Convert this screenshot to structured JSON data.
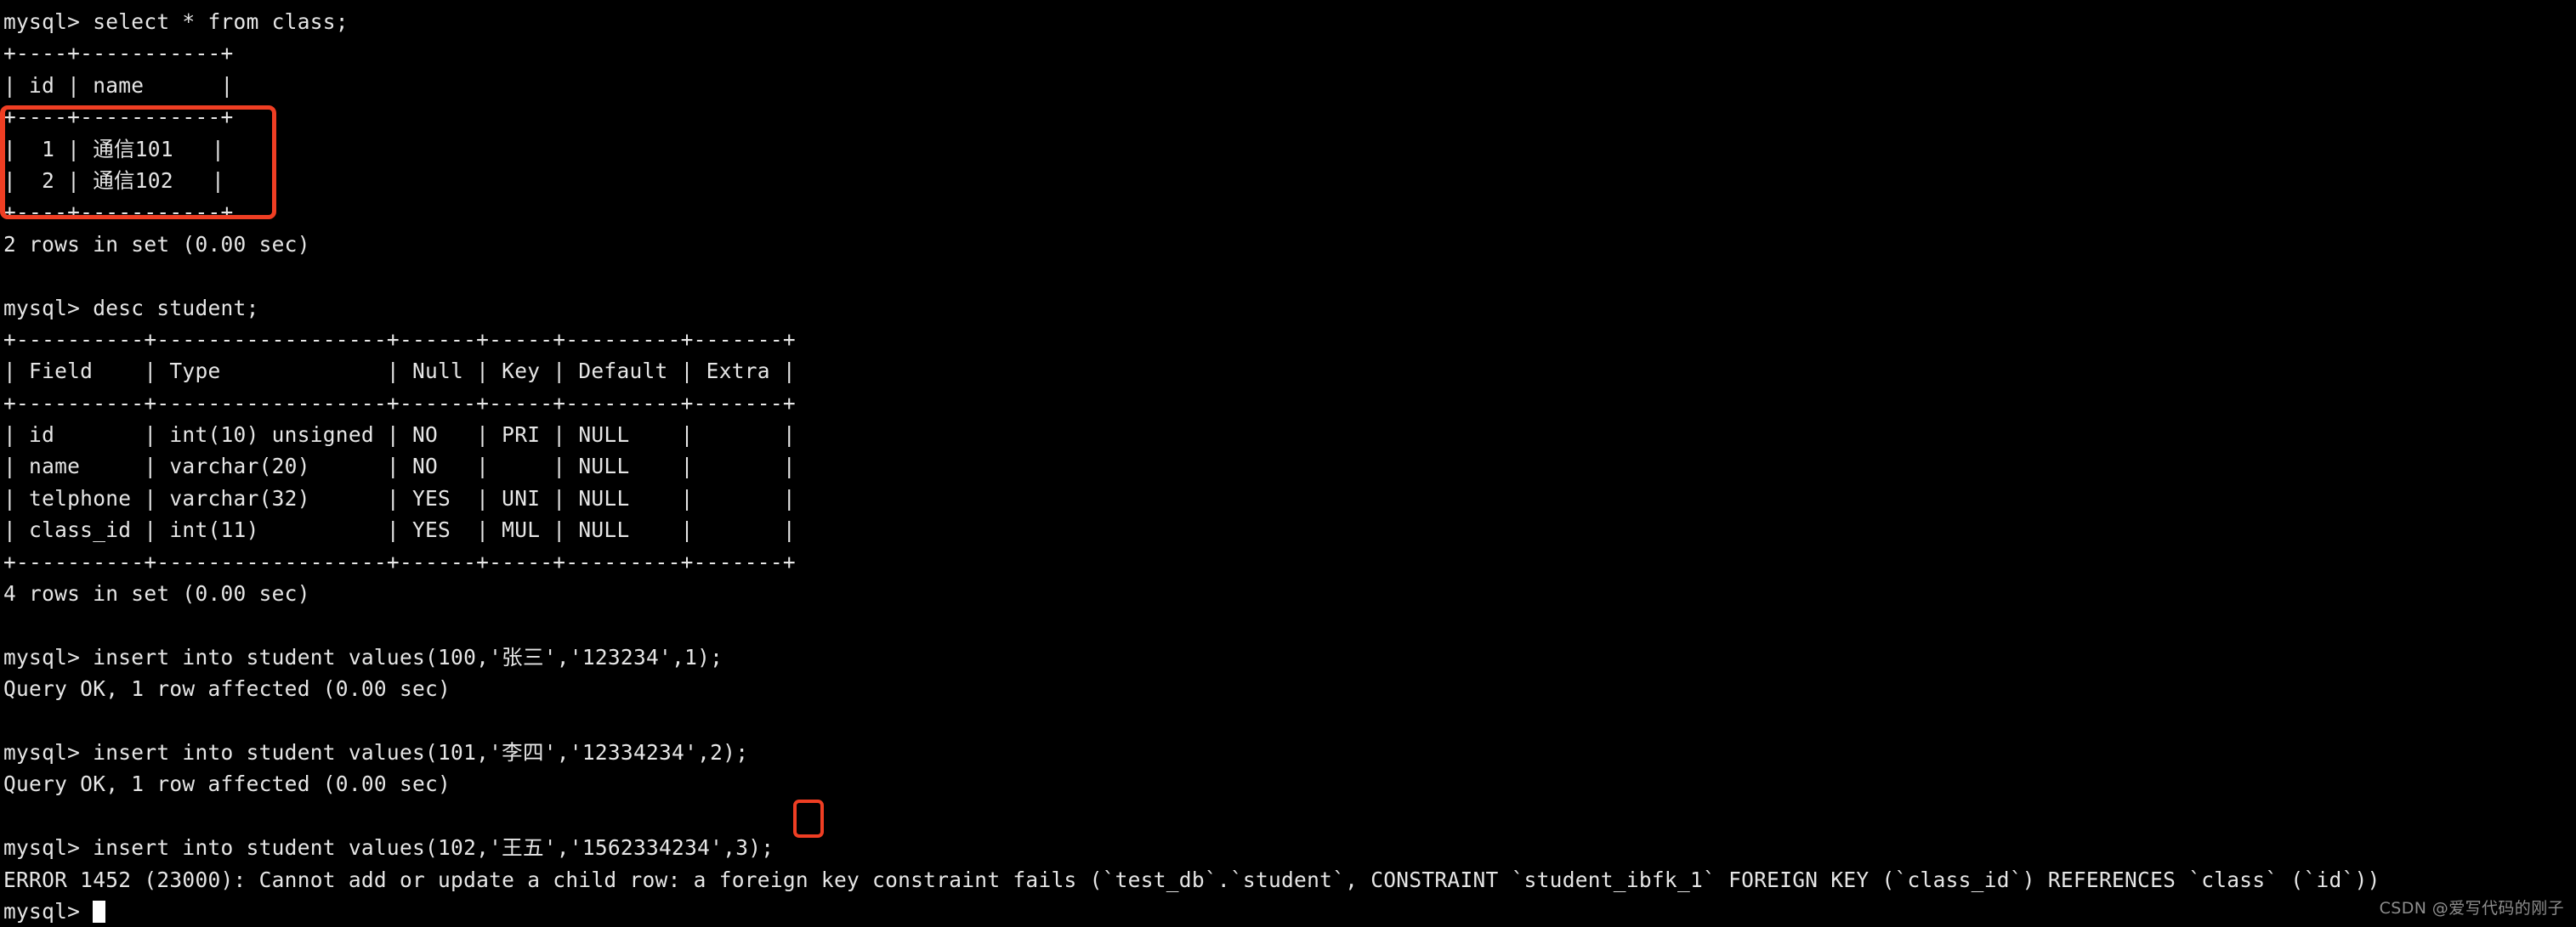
{
  "terminal": {
    "prompt": "mysql>",
    "background_color": "#000000",
    "text_color": "#e6e6e6",
    "annotation_color": "#ef3e23",
    "lines": [
      "mysql> select * from class;",
      "+----+-----------+",
      "| id | name      |",
      "+----+-----------+",
      "|  1 | 通信101   |",
      "|  2 | 通信102   |",
      "+----+-----------+",
      "2 rows in set (0.00 sec)",
      "",
      "mysql> desc student;",
      "+----------+------------------+------+-----+---------+-------+",
      "| Field    | Type             | Null | Key | Default | Extra |",
      "+----------+------------------+------+-----+---------+-------+",
      "| id       | int(10) unsigned | NO   | PRI | NULL    |       |",
      "| name     | varchar(20)      | NO   |     | NULL    |       |",
      "| telphone | varchar(32)      | YES  | UNI | NULL    |       |",
      "| class_id | int(11)          | YES  | MUL | NULL    |       |",
      "+----------+------------------+------+-----+---------+-------+",
      "4 rows in set (0.00 sec)",
      "",
      "mysql> insert into student values(100,'张三','123234',1);",
      "Query OK, 1 row affected (0.00 sec)",
      "",
      "mysql> insert into student values(101,'李四','12334234',2);",
      "Query OK, 1 row affected (0.00 sec)",
      "",
      "mysql> insert into student values(102,'王五','1562334234',3);",
      "ERROR 1452 (23000): Cannot add or update a child row: a foreign key constraint fails (`test_db`.`student`, CONSTRAINT `student_ibfk_1` FOREIGN KEY (`class_id`) REFERENCES `class` (`id`))"
    ],
    "final_prompt": "mysql> "
  },
  "queries": {
    "select_class": "select * from class;",
    "desc_student": "desc student;",
    "insert_1": "insert into student values(100,'张三','123234',1);",
    "insert_2": "insert into student values(101,'李四','12334234',2);",
    "insert_3": "insert into student values(102,'王五','1562334234',3);"
  },
  "class_table": {
    "headers": [
      "id",
      "name"
    ],
    "rows": [
      [
        "1",
        "通信101"
      ],
      [
        "2",
        "通信102"
      ]
    ],
    "result_status": "2 rows in set (0.00 sec)"
  },
  "student_schema": {
    "headers": [
      "Field",
      "Type",
      "Null",
      "Key",
      "Default",
      "Extra"
    ],
    "rows": [
      [
        "id",
        "int(10) unsigned",
        "NO",
        "PRI",
        "NULL",
        ""
      ],
      [
        "name",
        "varchar(20)",
        "NO",
        "",
        "NULL",
        ""
      ],
      [
        "telphone",
        "varchar(32)",
        "YES",
        "UNI",
        "NULL",
        ""
      ],
      [
        "class_id",
        "int(11)",
        "YES",
        "MUL",
        "NULL",
        ""
      ]
    ],
    "result_status": "4 rows in set (0.00 sec)"
  },
  "results": {
    "insert_ok_1": "Query OK, 1 row affected (0.00 sec)",
    "insert_ok_2": "Query OK, 1 row affected (0.00 sec)",
    "error": "ERROR 1452 (23000): Cannot add or update a child row: a foreign key constraint fails (`test_db`.`student`, CONSTRAINT `student_ibfk_1` FOREIGN KEY (`class_id`) REFERENCES `class` (`id`))",
    "error_code": "1452",
    "sql_state": "23000",
    "database": "test_db",
    "child_table": "student",
    "constraint_name": "student_ibfk_1",
    "foreign_key_column": "class_id",
    "referenced_table": "class",
    "referenced_column": "id"
  },
  "annotations": {
    "class_rows_box_label": "highlight-class-rows",
    "bad_class_id_box_label": "highlight-invalid-class-id",
    "bad_value": "3"
  },
  "watermark": {
    "text": "CSDN @爱写代码的刚子"
  }
}
